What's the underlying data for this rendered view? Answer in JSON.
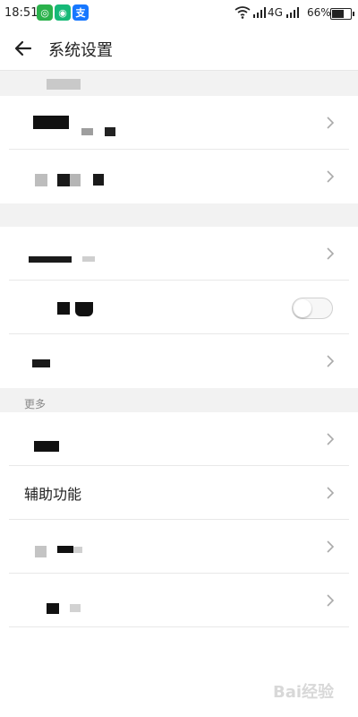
{
  "status_bar": {
    "time": "18:51",
    "network": "4G",
    "battery_percent": "66%",
    "battery_level": 0.66,
    "apps": [
      {
        "icon": "wechat-icon",
        "glyph": "◎",
        "color": "#2bb24c"
      },
      {
        "icon": "message-app-icon",
        "glyph": "◉",
        "color": "#17b978"
      },
      {
        "icon": "alipay-icon",
        "glyph": "支",
        "color": "#1677ff"
      }
    ]
  },
  "header": {
    "title": "系统设置",
    "back_icon": "arrow-left-icon"
  },
  "sections": {
    "more_label": "更多"
  },
  "items": {
    "accessibility_label": "辅助功能"
  },
  "watermark": "Bai经验"
}
